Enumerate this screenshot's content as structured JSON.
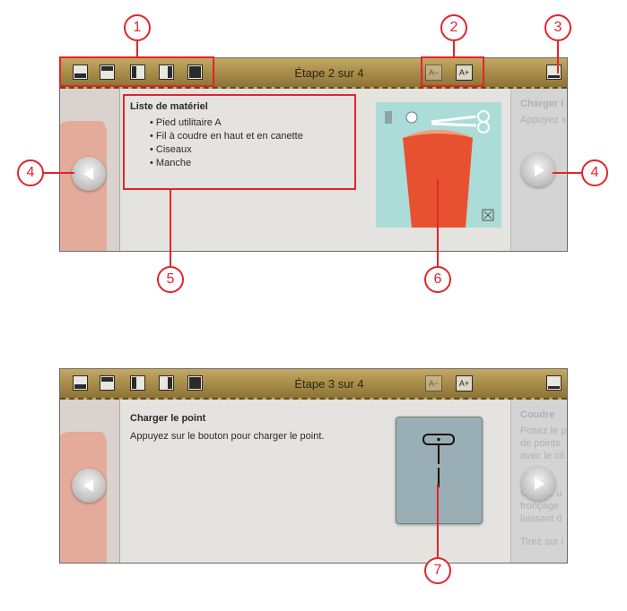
{
  "colors": {
    "accent": "#e3242b",
    "toolbar": "#a58a47",
    "panel": "#e4e3df",
    "garment": "#e8512f",
    "stitch_panel": "#9aafb5"
  },
  "callouts": [
    "1",
    "2",
    "3",
    "4",
    "4",
    "5",
    "6",
    "7"
  ],
  "screen1": {
    "step_label": "Étape 2 sur 4",
    "font_decrease": "A−",
    "font_increase": "A+",
    "layout_icons": [
      "layout-bottom-icon",
      "layout-top-icon",
      "layout-left-icon",
      "layout-right-icon",
      "layout-full-icon"
    ],
    "content_title": "Liste de matériel",
    "items": [
      "Pied utilitaire A",
      "Fil à coudre en haut et en canette",
      "Ciseaux",
      "Manche"
    ],
    "next_title": "Charger l",
    "next_body": "Appuyez s"
  },
  "screen2": {
    "step_label": "Étape 3 sur 4",
    "font_decrease": "A−",
    "font_increase": "A+",
    "content_title": "Charger le point",
    "content_body": "Appuyez sur le bouton pour charger le point.",
    "next_title": "Coudre",
    "next_lines": [
      "Posez le p",
      "de points",
      "avec le cô",
      "",
      "",
      "Cousez u",
      "fronçage",
      "laissant d",
      "",
      "Tirez sur l"
    ]
  }
}
